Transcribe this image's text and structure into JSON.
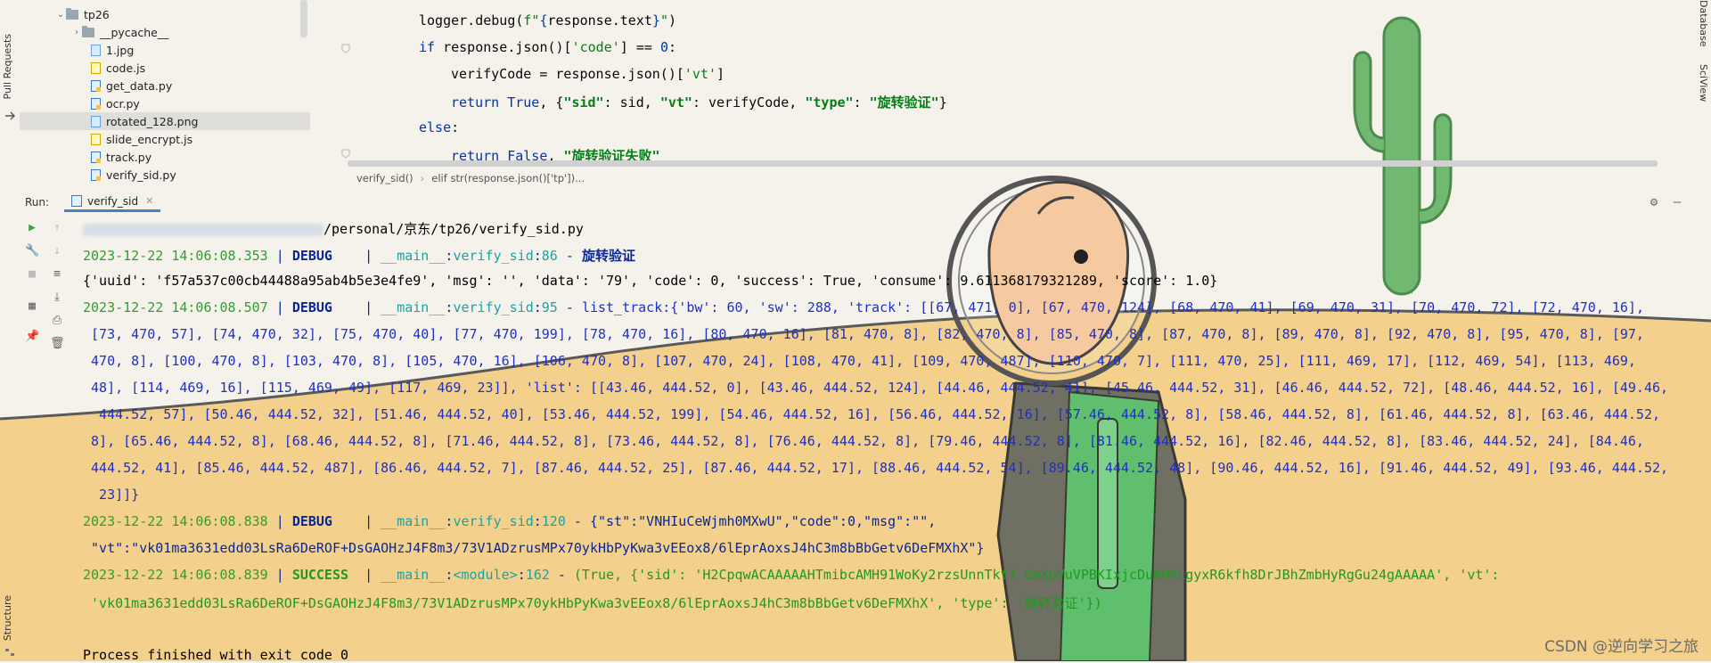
{
  "left_stripe": {
    "pull_requests": "Pull Requests",
    "structure": "Structure"
  },
  "right_stripe": {
    "database": "Database",
    "sciview": "SciView"
  },
  "tree": {
    "items": [
      {
        "label": "tp26",
        "kind": "folder",
        "expanded": true
      },
      {
        "label": "__pycache__",
        "kind": "folder",
        "expanded": false
      },
      {
        "label": "1.jpg",
        "kind": "img"
      },
      {
        "label": "code.js",
        "kind": "js"
      },
      {
        "label": "get_data.py",
        "kind": "py"
      },
      {
        "label": "ocr.py",
        "kind": "py"
      },
      {
        "label": "rotated_128.png",
        "kind": "img",
        "selected": true
      },
      {
        "label": "slide_encrypt.js",
        "kind": "js"
      },
      {
        "label": "track.py",
        "kind": "py"
      },
      {
        "label": "verify_sid.py",
        "kind": "py"
      }
    ]
  },
  "editor": {
    "lines": {
      "l1": {
        "pre": "logger.debug(",
        "s": "f\"",
        "b1": "{",
        "mid": "response.text",
        "b2": "}",
        "e": "\"",
        "post": ")"
      },
      "l2": {
        "kw": "if",
        "pre": " response.json()[",
        "s": "'code'",
        "mid": "] == ",
        "num": "0",
        "post": ":"
      },
      "l3": {
        "pre": "verifyCode = response.json()[",
        "s": "'vt'",
        "post": "]"
      },
      "l4": {
        "kw": "return",
        "kw2": " True",
        "pre": ", {",
        "s1": "\"sid\"",
        "p1": ": sid, ",
        "s2": "\"vt\"",
        "p2": ": verifyCode, ",
        "s3": "\"type\"",
        "p3": ": ",
        "s4": "\"旋转验证\"",
        "post": "}"
      },
      "l5": {
        "kw": "else",
        "post": ":"
      },
      "l6": {
        "kw": "return",
        "kw2": " False",
        "pre": ", ",
        "s": "\"旋转验证失败\""
      }
    },
    "breadcrumb": [
      "verify_sid()",
      "elif str(response.json()['tp'])..."
    ]
  },
  "run": {
    "label": "Run:",
    "tab": "verify_sid",
    "console": {
      "path": "/personal/京东/tp26/verify_sid.py",
      "log1": {
        "ts": "2023-12-22 14:06:08.353",
        "sep": " | ",
        "level": "DEBUG",
        "pad": "    | ",
        "mod": "__main__",
        "func": "verify_sid",
        "line": "86",
        "dash": " - ",
        "msg": "旋转验证"
      },
      "dict1": "{'uuid': 'f57a537c00cb44488a95ab4b5e3e4fe9', 'msg': '', 'data': '79', 'code': 0, 'success': True, 'consume': 9.611368179321289, 'score': 1.0}",
      "log2": {
        "ts": "2023-12-22 14:06:08.507",
        "sep": " | ",
        "level": "DEBUG",
        "pad": "    | ",
        "mod": "__main__",
        "func": "verify_sid",
        "line": "95",
        "dash": " - ",
        "msg": "list_track:{'bw': 60, 'sw': 288, 'track': [[67, 471, 0], [67, 470, 124], [68, 470, 41], [69, 470, 31], [70, 470, 72], [72, 470, 16],"
      },
      "track_lines": [
        " [73, 470, 57], [74, 470, 32], [75, 470, 40], [77, 470, 199], [78, 470, 16], [80, 470, 16], [81, 470, 8], [82, 470, 8], [85, 470, 8], [87, 470, 8], [89, 470, 8], [92, 470, 8], [95, 470, 8], [97,",
        " 470, 8], [100, 470, 8], [103, 470, 8], [105, 470, 16], [106, 470, 8], [107, 470, 24], [108, 470, 41], [109, 470, 487], [110, 470, 7], [111, 470, 25], [111, 469, 17], [112, 469, 54], [113, 469,",
        " 48], [114, 469, 16], [115, 469, 49], [117, 469, 23]], 'list': [[43.46, 444.52, 0], [43.46, 444.52, 124], [44.46, 444.52, 41], [45.46, 444.52, 31], [46.46, 444.52, 72], [48.46, 444.52, 16], [49.46,",
        "  444.52, 57], [50.46, 444.52, 32], [51.46, 444.52, 40], [53.46, 444.52, 199], [54.46, 444.52, 16], [56.46, 444.52, 16], [57.46, 444.52, 8], [58.46, 444.52, 8], [61.46, 444.52, 8], [63.46, 444.52,",
        " 8], [65.46, 444.52, 8], [68.46, 444.52, 8], [71.46, 444.52, 8], [73.46, 444.52, 8], [76.46, 444.52, 8], [79.46, 444.52, 8], [81.46, 444.52, 16], [82.46, 444.52, 8], [83.46, 444.52, 24], [84.46,",
        " 444.52, 41], [85.46, 444.52, 487], [86.46, 444.52, 7], [87.46, 444.52, 25], [87.46, 444.52, 17], [88.46, 444.52, 54], [89.46, 444.52, 48], [90.46, 444.52, 16], [91.46, 444.52, 49], [93.46, 444.52,",
        "  23]]}"
      ],
      "log3": {
        "ts": "2023-12-22 14:06:08.838",
        "sep": " | ",
        "level": "DEBUG",
        "pad": "    | ",
        "mod": "__main__",
        "func": "verify_sid",
        "line": "120",
        "dash": " - ",
        "msg": "{\"st\":\"VNHIuCeWjmh0MXwU\",\"code\":0,\"msg\":\"\","
      },
      "log3_cont": " \"vt\":\"vk01ma3631edd03LsRa6DeROF+DsGAOHzJ4F8m3/73V1ADzrusMPx70ykHbPyKwa3vEEox8/6lEprAoxsJ4hC3m8bBbGetv6DeFMXhX\"}",
      "log4": {
        "ts": "2023-12-22 14:06:08.839",
        "sep": " | ",
        "level": "SUCCESS",
        "pad": "  | ",
        "mod": "__main__",
        "func": "<module>",
        "line": "162",
        "dash": " - ",
        "msg": "(True, {'sid': 'H2CpqwACAAAAAHTmibcAMH91WoKy2rzsUnnTktf-GmXpVuVPBKIxjcDuKMRLgyxR6kfh8DrJBhZmbHyRgGu24gAAAAA', 'vt':"
      },
      "log4_cont": " 'vk01ma3631edd03LsRa6DeROF+DsGAOHzJ4F8m3/73V1ADzrusMPx70ykHbPyKwa3vEEox8/6lEprAoxsJ4hC3m8bBbGetv6DeFMXhX', 'type': '旋转验证'})",
      "finished": "Process finished with exit code 0"
    }
  },
  "watermark": "CSDN @逆向学习之旅",
  "colors": {
    "sky": "#f4f1ea",
    "sand": "#f4cf86",
    "cactus": "#6db56d",
    "skin": "#f6caa0",
    "accent_tab": "#4083c9"
  }
}
